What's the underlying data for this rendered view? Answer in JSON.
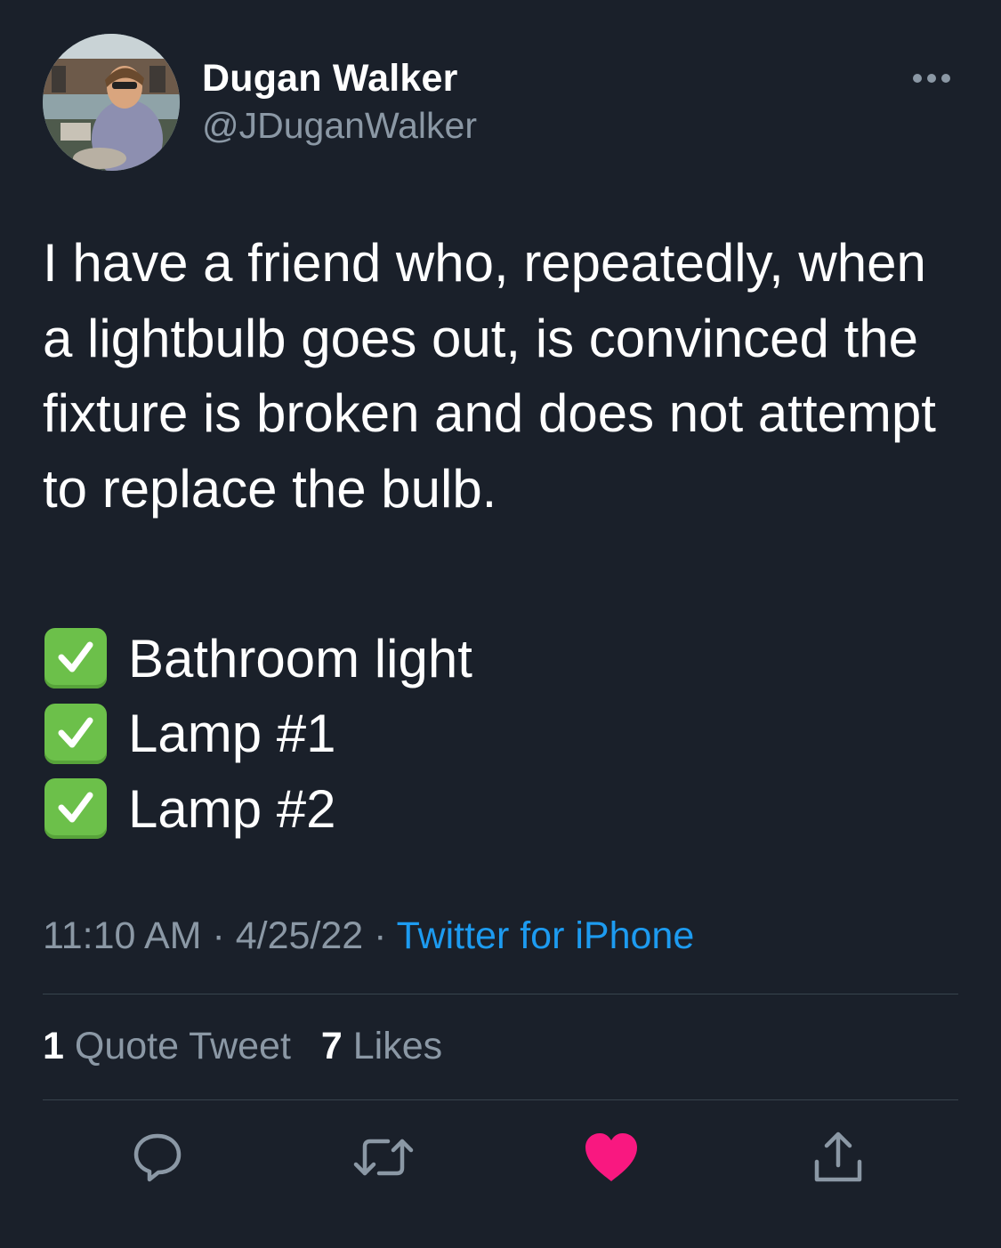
{
  "user": {
    "display_name": "Dugan Walker",
    "handle": "@JDuganWalker"
  },
  "tweet": {
    "text": "I have a friend who, repeatedly, when a lightbulb goes out, is convinced the fixture is broken and does not attempt to replace the bulb.",
    "checklist": [
      {
        "label": "Bathroom light",
        "checked": true
      },
      {
        "label": "Lamp #1",
        "checked": true
      },
      {
        "label": "Lamp #2",
        "checked": true
      }
    ],
    "time": "11:10 AM",
    "date": "4/25/22",
    "separator": "·",
    "source": "Twitter for iPhone"
  },
  "stats": {
    "quote_tweets_count": "1",
    "quote_tweets_label": "Quote Tweet",
    "likes_count": "7",
    "likes_label": "Likes"
  },
  "actions": [
    {
      "icon": "reply-icon"
    },
    {
      "icon": "retweet-icon"
    },
    {
      "icon": "like-icon",
      "active": true
    },
    {
      "icon": "share-icon"
    }
  ],
  "colors": {
    "background": "#1a202a",
    "text": "#ffffff",
    "secondary_text": "#8b98a5",
    "link": "#1d9bf0",
    "like_active": "#f91880",
    "checkbox": "#6cc04a",
    "divider": "#38444d"
  }
}
